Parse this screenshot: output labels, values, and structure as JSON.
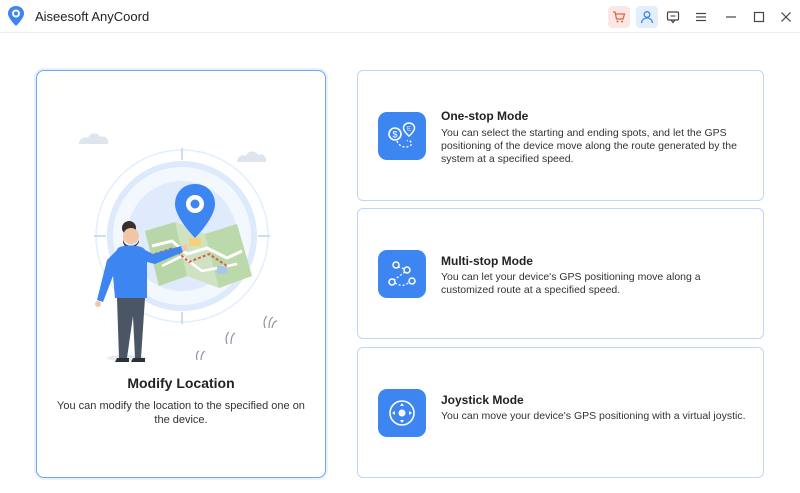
{
  "app": {
    "title": "Aiseesoft AnyCoord",
    "icons": [
      "location-pin-icon",
      "cart-icon",
      "user-icon",
      "chat-icon",
      "menu-icon",
      "minimize-icon",
      "maximize-icon",
      "close-icon"
    ]
  },
  "main_card": {
    "title": "Modify Location",
    "description": "You can modify the location to the specified one on the device."
  },
  "modes": [
    {
      "title": "One-stop Mode",
      "description": "You can select the starting and ending spots, and let the GPS positioning of the device move along the route generated by the system at a specified speed.",
      "icon": "one-stop-route-icon"
    },
    {
      "title": "Multi-stop Mode",
      "description": "You can let your device's GPS positioning move along a customized route at a specified speed.",
      "icon": "multi-stop-route-icon"
    },
    {
      "title": "Joystick Mode",
      "description": "You can move your device's GPS positioning with a virtual joystic.",
      "icon": "joystick-icon"
    }
  ],
  "colors": {
    "accent": "#3d86f2",
    "card_border_active": "#6aa6f2",
    "card_border": "#bcd7f7",
    "cart_bg": "#fbe8e4",
    "user_bg": "#e3eefc"
  }
}
